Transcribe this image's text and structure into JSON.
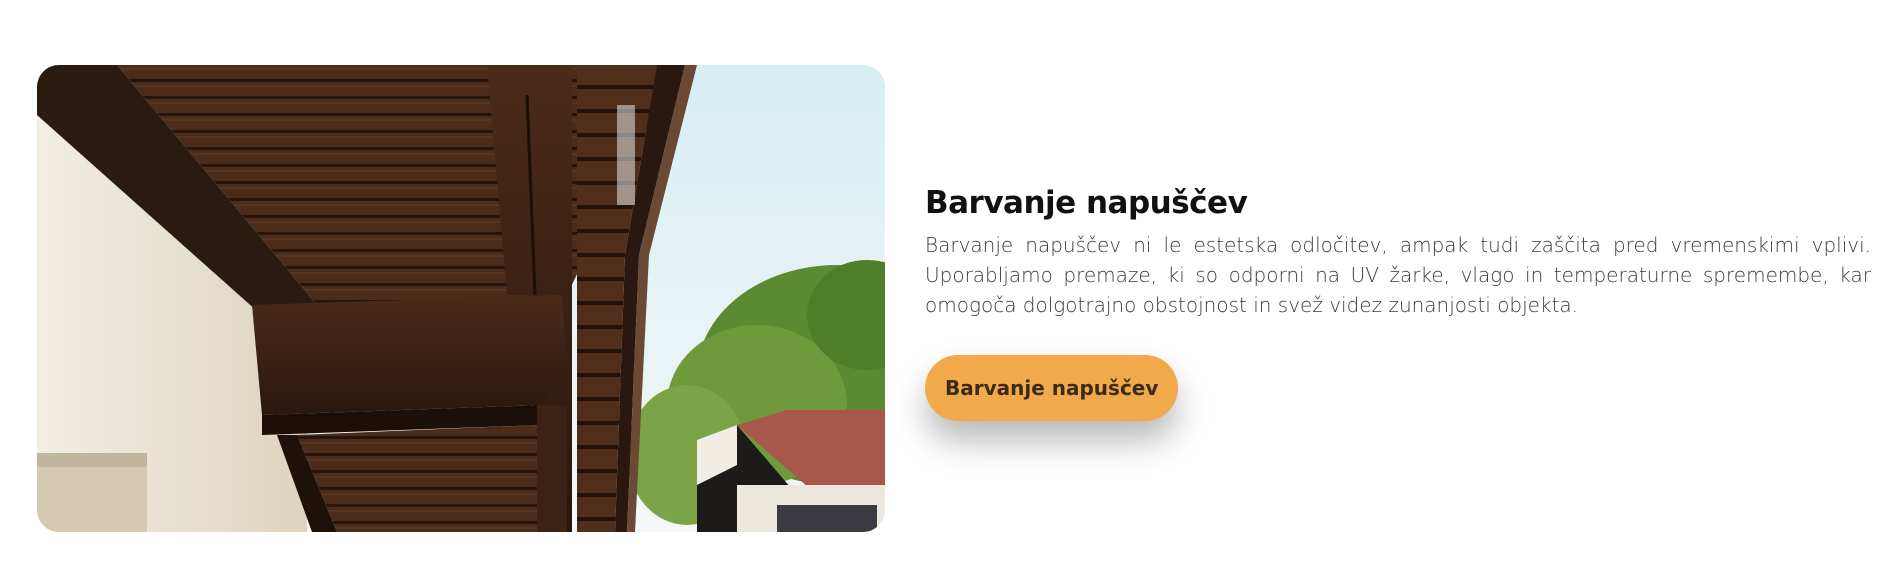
{
  "feature": {
    "image_alt": "Barvanje napuščev",
    "title": "Barvanje napuščev",
    "description": "Barvanje napuščev ni le estetska odločitev, ampak tudi zaščita pred vremenskimi vplivi. Uporabljamo premaze, ki so odporni na UV žarke, vlago in temperaturne spremembe, kar omogoča dolgotrajno obstojnost in svež videz zunanjosti objekta.",
    "button_label": "Barvanje napuščev"
  },
  "colors": {
    "button": "#f2a94b",
    "wood": "#4a2a18",
    "wall": "#ede7d8",
    "sky": "#e8f4f6"
  }
}
